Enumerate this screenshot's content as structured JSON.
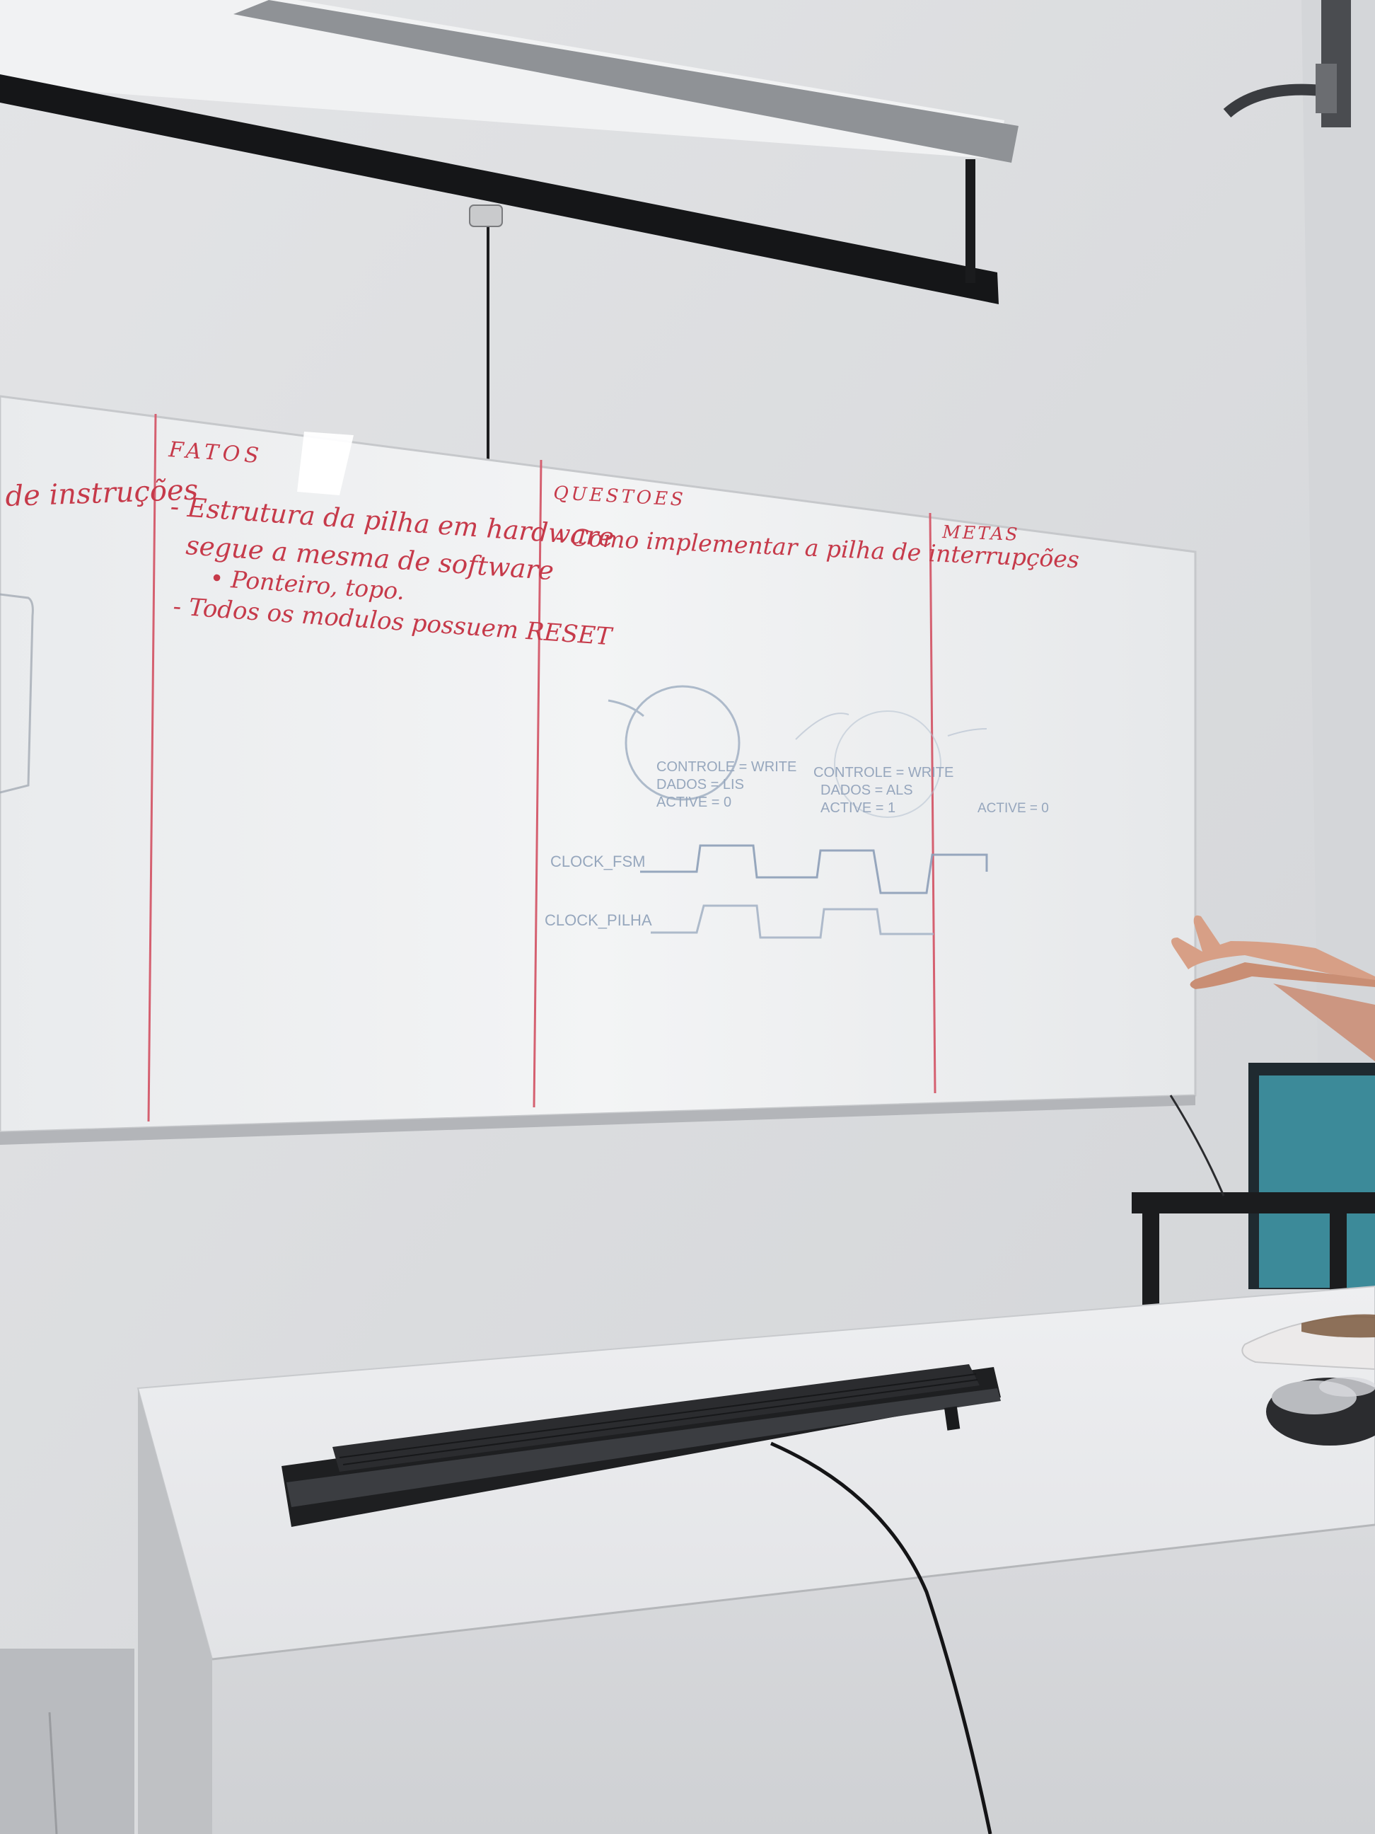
{
  "whiteboard": {
    "left_fragment": "de instruções",
    "columns": {
      "fatos": {
        "heading": "FATOS",
        "lines": [
          "- Estrutura da pilha em hardware",
          "segue a mesma de software",
          "• Ponteiro, topo.",
          "- Todos os modulos possuem RESET"
        ]
      },
      "questoes": {
        "heading": "QUESTOES",
        "lines": [
          "- Como implementar a pilha de interrupções"
        ]
      },
      "metas": {
        "heading": "METAS"
      }
    },
    "diagram": {
      "state_a": [
        "CONTROLE = WRITE",
        "DADOS = LIS",
        "ACTIVE = 0"
      ],
      "state_b": [
        "CONTROLE = WRITE",
        "DADOS = ALS",
        "ACTIVE = 1"
      ],
      "state_c": [
        "ACTIVE = 0"
      ],
      "signals": [
        "CLOCK_FSM",
        "CLOCK_PILHA"
      ]
    }
  },
  "colors": {
    "wall": "#dfe0e2",
    "board": "#eef0f1",
    "red_marker": "#c63a4a",
    "blue_marker": "#8d9fb8",
    "desk": "#e9eaec",
    "keyboard": "#232426"
  }
}
